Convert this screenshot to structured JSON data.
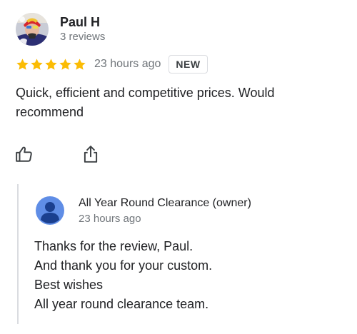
{
  "review": {
    "author": {
      "name": "Paul H",
      "meta": "3 reviews",
      "avatar_icon": "user-photo-avatar"
    },
    "rating": {
      "stars": 5,
      "max_stars": 5,
      "star_color": "#fbbc04",
      "time_ago": "23 hours ago",
      "badge": "NEW"
    },
    "text": "Quick, efficient and competitive prices. Would recommend",
    "actions": {
      "like_icon": "thumbs-up-icon",
      "share_icon": "share-icon"
    }
  },
  "owner_reply": {
    "name": "All Year Round Clearance (owner)",
    "time_ago": "23 hours ago",
    "avatar_icon": "default-person-avatar",
    "avatar_color": "#5f8de6",
    "lines": [
      "Thanks for the review, Paul.",
      "And thank you for your custom.",
      "Best wishes",
      "All year round clearance team."
    ]
  }
}
